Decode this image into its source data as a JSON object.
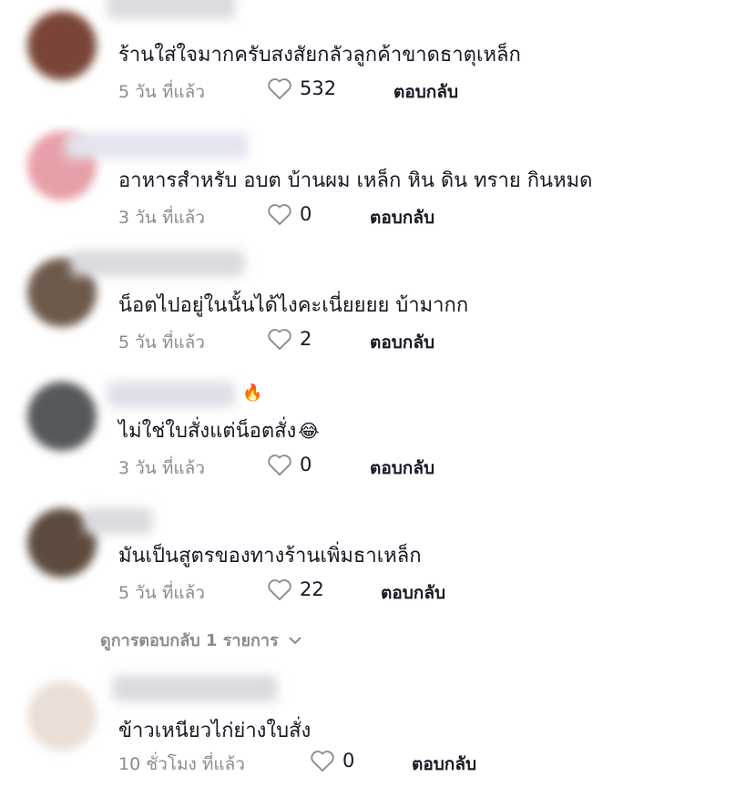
{
  "comments": [
    {
      "text": "ร้านใส่ใจมากครับสงสัยกลัวลูกค้าขาดธาตุเหล็ก",
      "time": "5 วัน ที่แล้ว",
      "likes": "532",
      "reply": "ตอบกลับ"
    },
    {
      "text": "อาหารสำหรับ อบต บ้านผม เหล็ก หิน ดิน ทราย กินหมด",
      "time": "3 วัน ที่แล้ว",
      "likes": "0",
      "reply": "ตอบกลับ"
    },
    {
      "text": "น็อตไปอยู่ในนั้นได้ไงคะเนี่ยยยย บ้ามากก",
      "time": "5 วัน ที่แล้ว",
      "likes": "2",
      "reply": "ตอบกลับ"
    },
    {
      "text": "ไม่ใช่ใบสั่งแต่น็อตสั่ง",
      "emoji": "😂",
      "username_emoji": "🔥",
      "time": "3 วัน ที่แล้ว",
      "likes": "0",
      "reply": "ตอบกลับ"
    },
    {
      "text": "มันเป็นสูตรของทางร้านเพิ่มธาเหล็ก",
      "time": "5 วัน ที่แล้ว",
      "likes": "22",
      "reply": "ตอบกลับ"
    },
    {
      "text": "ข้าวเหนียวไก่ย่างใบสั่ง",
      "time": "10 ชั่วโมง ที่แล้ว",
      "likes": "0",
      "reply": "ตอบกลับ"
    }
  ],
  "view_replies": "ดูการตอบกลับ 1 รายการ",
  "icons": {
    "like": "heart-outline-icon",
    "expand": "chevron-down-icon"
  },
  "colors": {
    "text": "#161823",
    "muted": "#8a8b91"
  }
}
